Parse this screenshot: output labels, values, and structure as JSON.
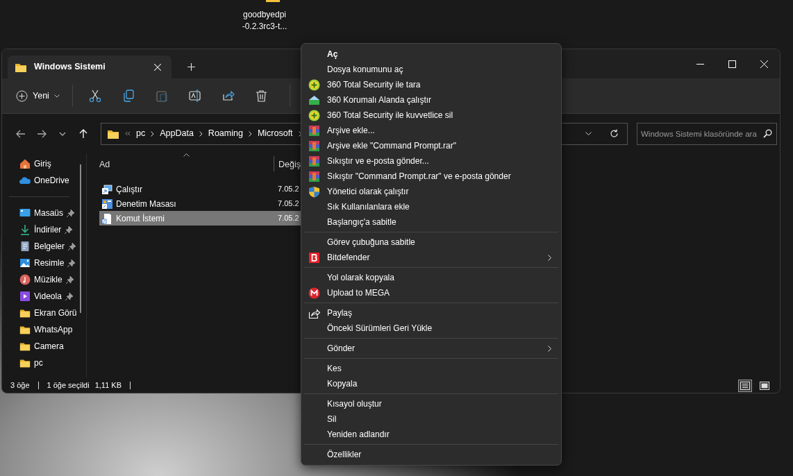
{
  "desktop": {
    "icon_label_lines": [
      "goodbyedpi",
      "-0.2.3rc3-t..."
    ]
  },
  "window": {
    "tab": {
      "title": "Windows Sistemi"
    },
    "toolbar": {
      "new_label": "Yeni",
      "buttons": [
        {
          "kind": "cut",
          "disabled": false
        },
        {
          "kind": "copy",
          "disabled": false
        },
        {
          "kind": "paste",
          "disabled": true
        },
        {
          "kind": "rename",
          "disabled": false
        },
        {
          "kind": "share",
          "disabled": false
        },
        {
          "kind": "delete",
          "disabled": false
        }
      ]
    },
    "address": {
      "breadcrumbs": [
        "pc",
        "AppData",
        "Roaming",
        "Microsoft"
      ]
    },
    "search": {
      "placeholder": "Windows Sistemi klasöründe ara"
    },
    "sidebar": {
      "groups": [
        [
          {
            "label": "Giriş",
            "kind": "home",
            "pinned": false
          },
          {
            "label": "OneDrive",
            "kind": "cloud",
            "pinned": false
          }
        ],
        [
          {
            "label": "Masaüs",
            "kind": "desktop",
            "pinned": true
          },
          {
            "label": "İndiriler",
            "kind": "download",
            "pinned": true
          },
          {
            "label": "Belgeler",
            "kind": "document",
            "pinned": true
          },
          {
            "label": "Resimle",
            "kind": "picture",
            "pinned": true
          },
          {
            "label": "Müzikle",
            "kind": "music",
            "pinned": true
          },
          {
            "label": "Videola",
            "kind": "video",
            "pinned": true
          },
          {
            "label": "Ekran Görü",
            "kind": "folder",
            "pinned": false
          },
          {
            "label": "WhatsApp",
            "kind": "folder",
            "pinned": false
          },
          {
            "label": "Camera",
            "kind": "folder",
            "pinned": false
          },
          {
            "label": "pc",
            "kind": "folder",
            "pinned": false
          }
        ]
      ]
    },
    "table": {
      "columns": [
        "Ad",
        "Değiş"
      ],
      "rows": [
        {
          "name": "Çalıştır",
          "date": "7.05.2",
          "kind": "run",
          "selected": false
        },
        {
          "name": "Denetim Masası",
          "date": "7.05.2",
          "kind": "control-panel",
          "selected": false
        },
        {
          "name": "Komut İstemi",
          "date": "7.05.2",
          "kind": "file",
          "selected": true
        }
      ]
    },
    "status_bar": [
      "3 öğe",
      "1 öğe seçildi",
      "1,11 KB"
    ],
    "views": [
      {
        "kind": "details",
        "selected": true
      },
      {
        "kind": "tiles",
        "selected": false
      }
    ]
  },
  "context_menu": {
    "groups": [
      [
        {
          "label": "Aç",
          "kind": "plain",
          "default": true,
          "submenu": false
        },
        {
          "label": "Dosya konumunu aç",
          "kind": "plain",
          "default": false,
          "submenu": false
        },
        {
          "label": "360 Total Security ile tara",
          "kind": "plus-circle",
          "default": false,
          "submenu": false
        },
        {
          "label": "360 Korumalı Alanda çalıştır",
          "kind": "sandbox",
          "default": false,
          "submenu": false
        },
        {
          "label": "360 Total Security ile kuvvetlice sil",
          "kind": "plus-circle",
          "default": false,
          "submenu": false
        },
        {
          "label": "Arşive ekle...",
          "kind": "archive",
          "default": false,
          "submenu": false
        },
        {
          "label": "Arşive ekle \"Command Prompt.rar\"",
          "kind": "archive",
          "default": false,
          "submenu": false
        },
        {
          "label": "Sıkıştır ve e-posta gönder...",
          "kind": "archive",
          "default": false,
          "submenu": false
        },
        {
          "label": "Sıkıştır \"Command Prompt.rar\" ve e-posta gönder",
          "kind": "archive",
          "default": false,
          "submenu": false
        },
        {
          "label": "Yönetici olarak çalıştır",
          "kind": "shield",
          "default": false,
          "submenu": false
        },
        {
          "label": "Sık Kullanılanlara ekle",
          "kind": "plain",
          "default": false,
          "submenu": false
        },
        {
          "label": "Başlangıç'a sabitle",
          "kind": "plain",
          "default": false,
          "submenu": false
        }
      ],
      [
        {
          "label": "Görev çubuğuna sabitle",
          "kind": "plain",
          "default": false,
          "submenu": false
        },
        {
          "label": "Bitdefender",
          "kind": "b-square",
          "default": false,
          "submenu": true
        }
      ],
      [
        {
          "label": "Yol olarak kopyala",
          "kind": "plain",
          "default": false,
          "submenu": false
        },
        {
          "label": "Upload to MEGA",
          "kind": "m-circle",
          "default": false,
          "submenu": false
        }
      ],
      [
        {
          "label": "Paylaş",
          "kind": "share",
          "default": false,
          "submenu": false
        },
        {
          "label": "Önceki Sürümleri Geri Yükle",
          "kind": "plain",
          "default": false,
          "submenu": false
        }
      ],
      [
        {
          "label": "Gönder",
          "kind": "plain",
          "default": false,
          "submenu": true
        }
      ],
      [
        {
          "label": "Kes",
          "kind": "plain",
          "default": false,
          "submenu": false
        },
        {
          "label": "Kopyala",
          "kind": "plain",
          "default": false,
          "submenu": false
        }
      ],
      [
        {
          "label": "Kısayol oluştur",
          "kind": "plain",
          "default": false,
          "submenu": false
        },
        {
          "label": "Sil",
          "kind": "plain",
          "default": false,
          "submenu": false
        },
        {
          "label": "Yeniden adlandır",
          "kind": "plain",
          "default": false,
          "submenu": false
        }
      ],
      [
        {
          "label": "Özellikler",
          "kind": "plain",
          "default": false,
          "submenu": false
        }
      ]
    ]
  }
}
